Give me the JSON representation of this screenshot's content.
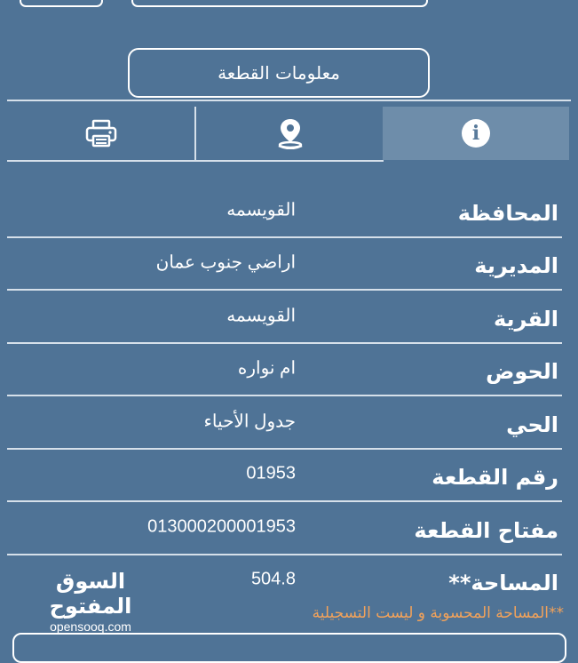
{
  "header": {
    "title": "معلومات القطعة"
  },
  "tabs": [
    {
      "name": "print",
      "icon": "printer-icon"
    },
    {
      "name": "location",
      "icon": "location-pin-icon"
    },
    {
      "name": "info",
      "icon": "info-icon",
      "active": true
    }
  ],
  "rows": [
    {
      "label": "المحافظة",
      "value": "القويسمه"
    },
    {
      "label": "المديرية",
      "value": "اراضي جنوب عمان"
    },
    {
      "label": "القرية",
      "value": "القويسمه"
    },
    {
      "label": "الحوض",
      "value": "ام نواره"
    },
    {
      "label": "الحي",
      "value": "جدول الأحياء"
    },
    {
      "label": "رقم القطعة",
      "value": "01953"
    },
    {
      "label": "مفتاح القطعة",
      "value": "013000200001953"
    },
    {
      "label": "المساحة**",
      "value": "504.8"
    }
  ],
  "footnote": "**المساحة المحسوبة و ليست التسجيلية",
  "watermark": {
    "arabic": "السوق المفتوح",
    "latin": "opensooq.com"
  },
  "colors": {
    "background": "#4f7396",
    "active_tab": "#6e8daa",
    "footnote": "#f2a25a"
  }
}
